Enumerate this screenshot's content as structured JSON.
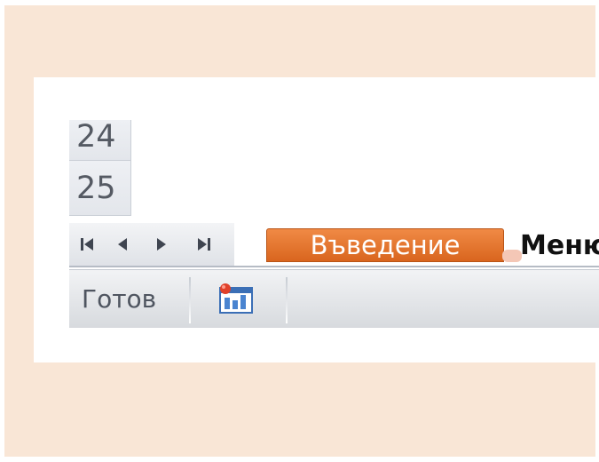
{
  "rows": [
    {
      "number": "24"
    },
    {
      "number": "25"
    }
  ],
  "sheet_navigation": {
    "buttons": [
      {
        "icon": "first-sheet-icon"
      },
      {
        "icon": "previous-sheet-icon"
      },
      {
        "icon": "next-sheet-icon"
      },
      {
        "icon": "last-sheet-icon"
      }
    ]
  },
  "sheet_tabs": [
    {
      "label": "Въведение",
      "active": true
    },
    {
      "label": "Меню",
      "active": false
    }
  ],
  "statusbar": {
    "status": "Готов",
    "macro_icon": "record-macro-icon"
  },
  "colors": {
    "background": "#f9e6d6",
    "active_tab": "#e8752e",
    "active_tab_text": "#ffffff",
    "inactive_tab_text": "#111111"
  }
}
